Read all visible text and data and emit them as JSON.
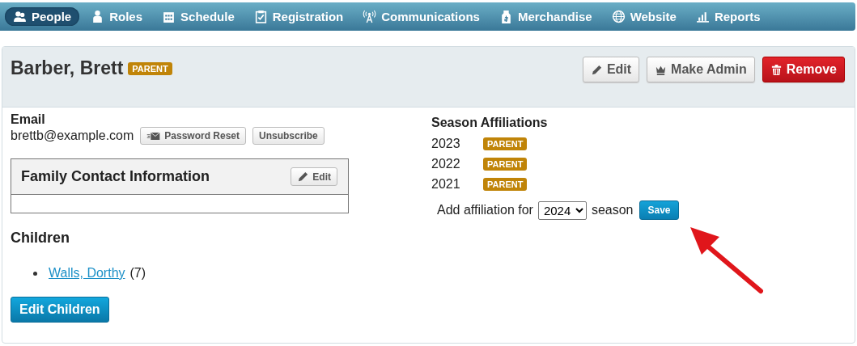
{
  "nav": [
    {
      "label": "People",
      "kind": "people",
      "selected": true
    },
    {
      "label": "Roles",
      "kind": "person",
      "selected": false
    },
    {
      "label": "Schedule",
      "kind": "calendar",
      "selected": false
    },
    {
      "label": "Registration",
      "kind": "clipboard",
      "selected": false
    },
    {
      "label": "Communications",
      "kind": "antenna",
      "selected": false
    },
    {
      "label": "Merchandise",
      "kind": "tag",
      "selected": false
    },
    {
      "label": "Website",
      "kind": "globe",
      "selected": false
    },
    {
      "label": "Reports",
      "kind": "chart",
      "selected": false
    }
  ],
  "header": {
    "name": "Barber, Brett",
    "badge": "PARENT",
    "actions": [
      {
        "label": "Edit",
        "kind": "edit"
      },
      {
        "label": "Make Admin",
        "kind": "admin"
      },
      {
        "label": "Remove",
        "kind": "remove"
      }
    ]
  },
  "email": {
    "label": "Email",
    "value": "brettb@example.com",
    "buttons": [
      {
        "label": "Password Reset",
        "kind": "reset"
      },
      {
        "label": "Unsubscribe",
        "kind": "plain"
      }
    ]
  },
  "family_contact": {
    "title": "Family Contact Information",
    "edit": "Edit"
  },
  "children": {
    "title": "Children",
    "items": [
      {
        "name": "Walls, Dorthy",
        "age": "(7)"
      }
    ],
    "button": "Edit Children"
  },
  "affiliations": {
    "title": "Season Affiliations",
    "rows": [
      {
        "year": "2023",
        "badge": "PARENT"
      },
      {
        "year": "2022",
        "badge": "PARENT"
      },
      {
        "year": "2021",
        "badge": "PARENT"
      }
    ],
    "add_prefix": "Add affiliation for",
    "season_value": "2024",
    "add_suffix": "season",
    "save": "Save"
  }
}
